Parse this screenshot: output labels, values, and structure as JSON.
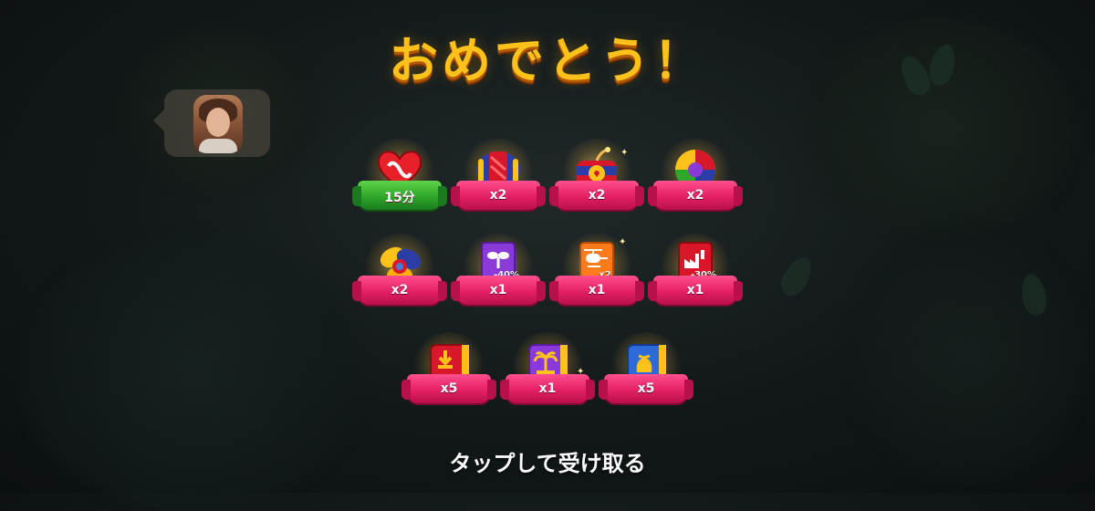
{
  "title": "おめでとう！",
  "tap_prompt": "タップして受け取る",
  "rewards": [
    {
      "icon": "infinite-lives-heart-icon",
      "count": "15分",
      "ribbon": "green"
    },
    {
      "icon": "rocket-booster-icon",
      "count": "x2"
    },
    {
      "icon": "tnt-bomb-booster-icon",
      "count": "x2"
    },
    {
      "icon": "color-ball-booster-icon",
      "count": "x2"
    },
    {
      "icon": "propeller-booster-icon",
      "count": "x2"
    },
    {
      "icon": "plant-discount-card-icon",
      "label": "-40%",
      "count": "x1"
    },
    {
      "icon": "helicopter-card-icon",
      "label": "x2",
      "count": "x1"
    },
    {
      "icon": "factory-discount-card-icon",
      "label": "-30%",
      "count": "x1"
    },
    {
      "icon": "download-ticket-icon",
      "count": "x5"
    },
    {
      "icon": "palm-tree-ticket-icon",
      "count": "x1"
    },
    {
      "icon": "sack-ticket-icon",
      "count": "x5"
    }
  ],
  "colors": {
    "title": "#ffc21a",
    "ribbon": "#e41f63",
    "ribbon_green": "#2ea72a",
    "background": "#121818"
  }
}
